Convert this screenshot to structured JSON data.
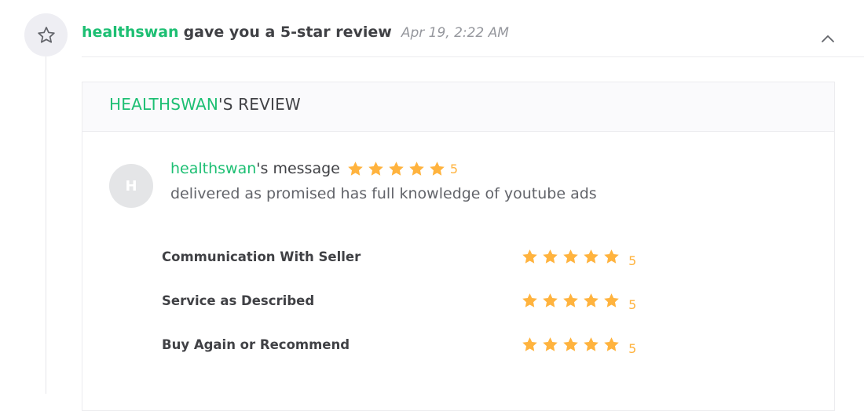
{
  "event": {
    "icon": "star-outline-icon",
    "user": "healthswan",
    "text": "gave you a 5-star review",
    "time": "Apr 19, 2:22 AM",
    "toggle_icon": "chevron-up-icon"
  },
  "review": {
    "title_user": "HEALTHSWAN",
    "title_suffix": "'S REVIEW",
    "avatar_initial": "H",
    "message_user": "healthswan",
    "message_suffix": "'s message",
    "overall_rating": 5,
    "overall_rating_label": "5",
    "message": "delivered as promised has full knowledge of youtube ads",
    "criteria": [
      {
        "label": "Communication With Seller",
        "rating": 5,
        "rating_label": "5"
      },
      {
        "label": "Service as Described",
        "rating": 5,
        "rating_label": "5"
      },
      {
        "label": "Buy Again or Recommend",
        "rating": 5,
        "rating_label": "5"
      }
    ]
  },
  "colors": {
    "brand_green": "#1dbf73",
    "star_orange": "#ffb33e",
    "text_dark": "#404145",
    "text_muted": "#95979d"
  }
}
